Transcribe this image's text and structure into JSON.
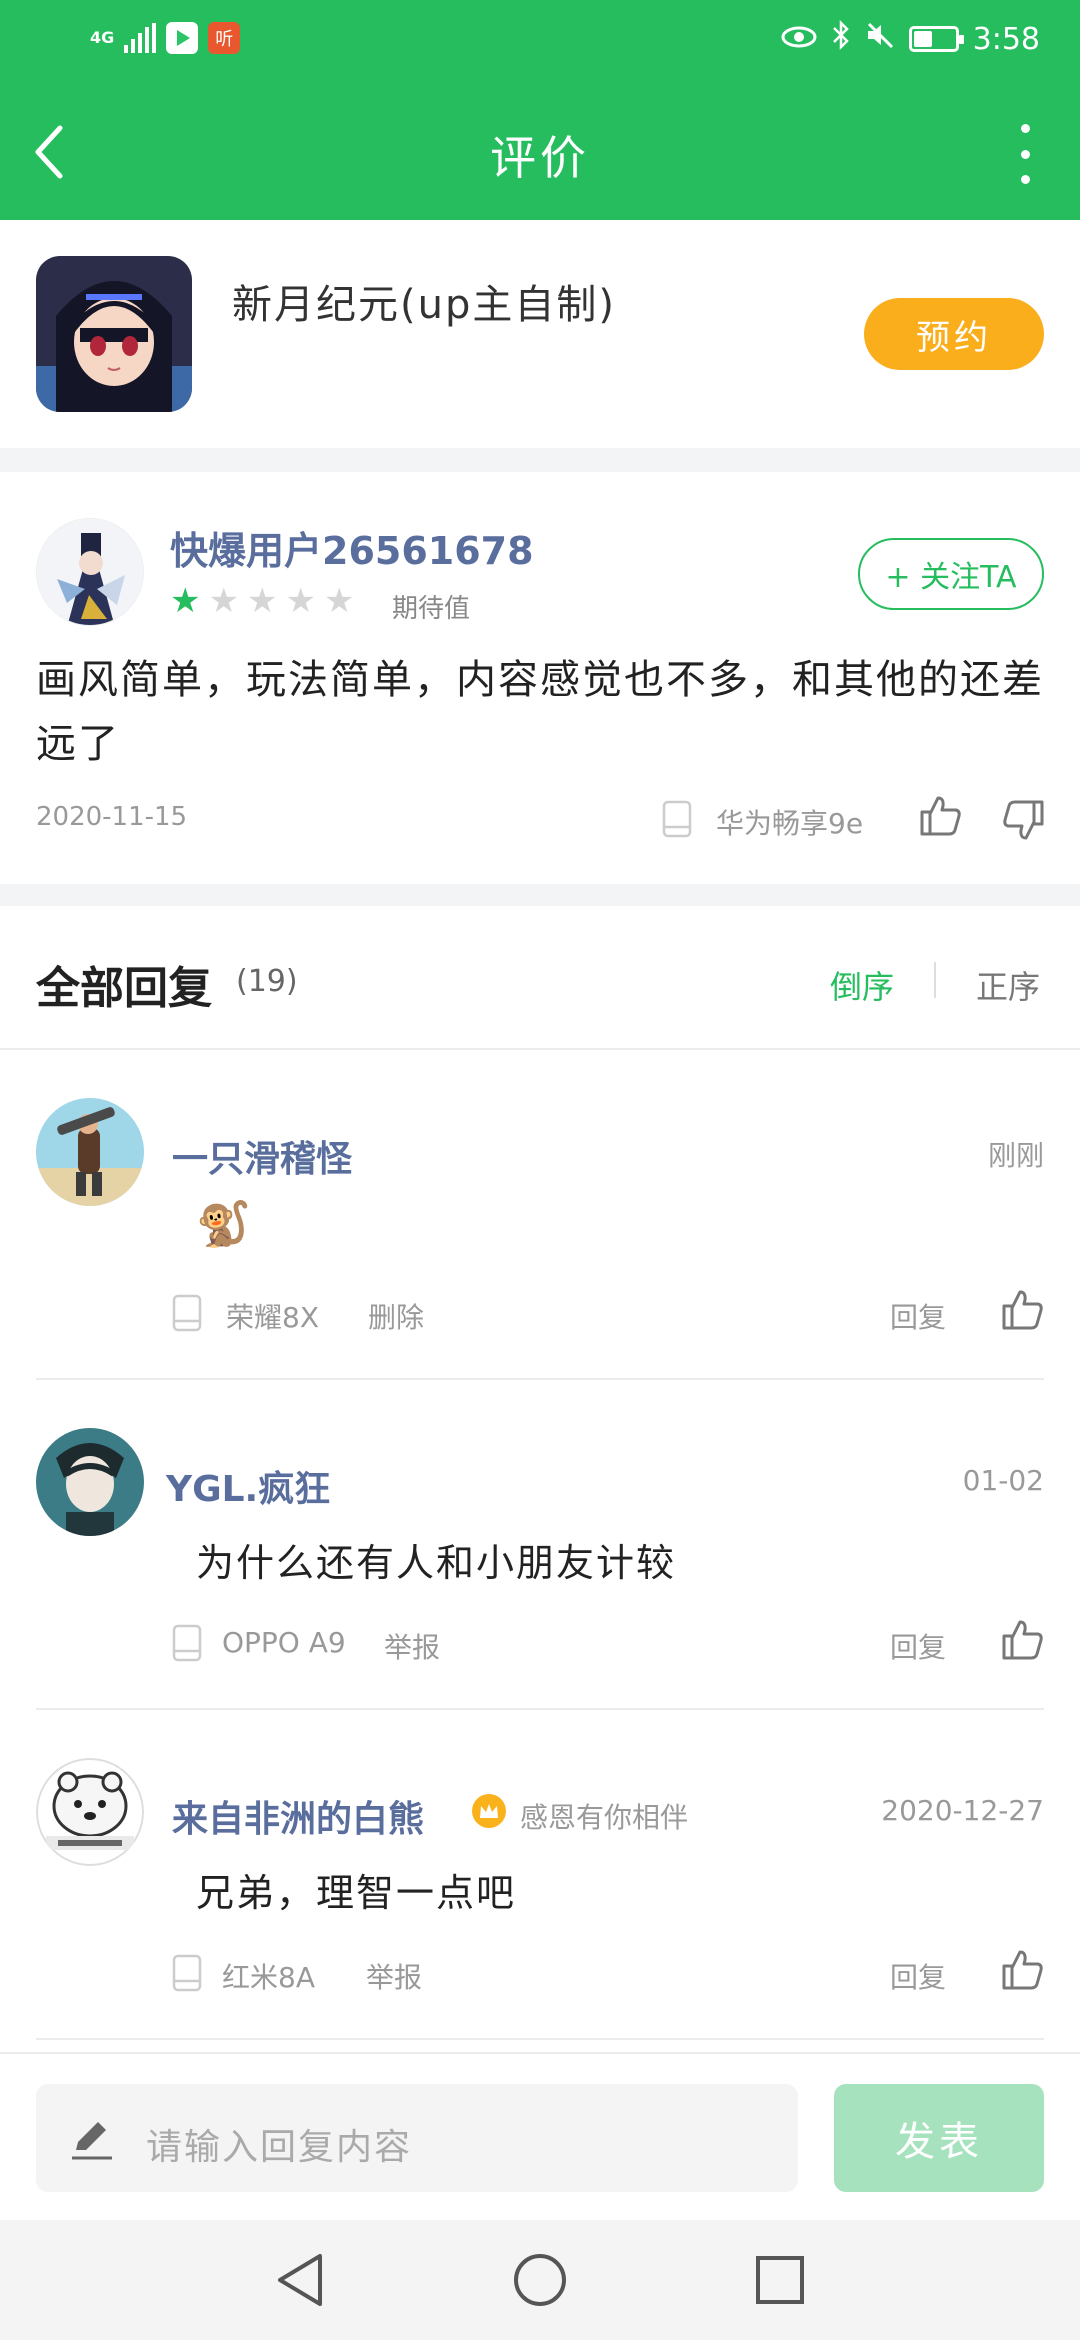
{
  "status_bar": {
    "network": "4G",
    "time": "3:58",
    "battery_level": 0.45
  },
  "nav": {
    "title": "评价"
  },
  "game": {
    "title": "新月纪元(up主自制)",
    "reserve_label": "预约"
  },
  "review": {
    "user_name": "快爆用户26561678",
    "rating": 1,
    "rating_max": 5,
    "rating_label": "期待值",
    "follow_label": "+ 关注TA",
    "content": "画风简单，玩法简单，内容感觉也不多，和其他的还差远了",
    "date": "2020-11-15",
    "device": "华为畅享9e"
  },
  "replies_header": {
    "title": "全部回复",
    "count": "(19)",
    "sort_desc": "倒序",
    "sort_asc": "正序"
  },
  "replies": [
    {
      "name": "一只滑稽怪",
      "time": "刚刚",
      "content": "🐒",
      "device": "荣耀8X",
      "action": "删除",
      "reply_label": "回复"
    },
    {
      "name": "YGL.疯狂",
      "time": "01-02",
      "content": "为什么还有人和小朋友计较",
      "device": "OPPO A9",
      "action": "举报",
      "reply_label": "回复"
    },
    {
      "name": "来自非洲的白熊",
      "badge": "感恩有你相伴",
      "time": "2020-12-27",
      "content": "兄弟，理智一点吧",
      "device": "红米8A",
      "action": "举报",
      "reply_label": "回复"
    }
  ],
  "input": {
    "placeholder": "请输入回复内容",
    "publish_label": "发表"
  },
  "colors": {
    "primary": "#26bd5f",
    "reserve": "#fbae1c",
    "name": "#5a6e9e"
  }
}
